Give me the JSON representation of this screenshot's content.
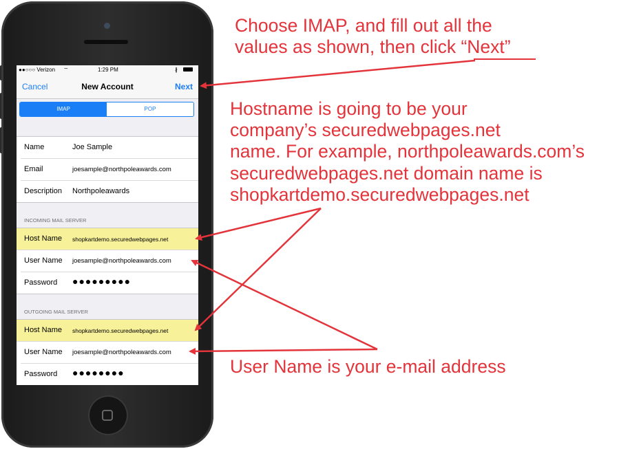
{
  "status_bar": {
    "carrier": "●●○○○ Verizon",
    "wifi": "⌔",
    "time": "1:29 PM",
    "bt": "∦"
  },
  "nav": {
    "cancel": "Cancel",
    "title": "New Account",
    "next": "Next"
  },
  "segment": {
    "options": [
      "IMAP",
      "POP"
    ],
    "selected": "IMAP"
  },
  "account": [
    {
      "label": "Name",
      "value": "Joe Sample"
    },
    {
      "label": "Email",
      "value": "joesample@northpoleawards.com"
    },
    {
      "label": "Description",
      "value": "Northpoleawards"
    }
  ],
  "incoming": {
    "header": "INCOMING MAIL SERVER",
    "host_label": "Host Name",
    "host_value": "shopkartdemo.securedwebpages.net",
    "user_label": "User Name",
    "user_value": "joesample@northpoleawards.com",
    "pass_label": "Password",
    "pass_value": "●●●●●●●●●"
  },
  "outgoing": {
    "header": "OUTGOING MAIL SERVER",
    "host_label": "Host Name",
    "host_value": "shopkartdemo.securedwebpages.net",
    "user_label": "User Name",
    "user_value": "joesample@northpoleawards.com",
    "pass_label": "Password",
    "pass_value": "●●●●●●●●"
  },
  "callouts": {
    "top_line1": "Choose IMAP, and fill out all the",
    "top_line2": "values as shown, then click “Next”",
    "host_line1": "Hostname is going to be your",
    "host_line2": "company’s securedwebpages.net",
    "host_line3": "name.  For example, northpoleawards.com’s",
    "host_line4": "securedwebpages.net domain name is",
    "host_line5": "shopkartdemo.securedwebpages.net",
    "user_line": "User Name is your e-mail address"
  },
  "colors": {
    "annotation": "#e3343b",
    "ios_blue": "#1a7ef7",
    "highlight": "#f7f19a"
  }
}
